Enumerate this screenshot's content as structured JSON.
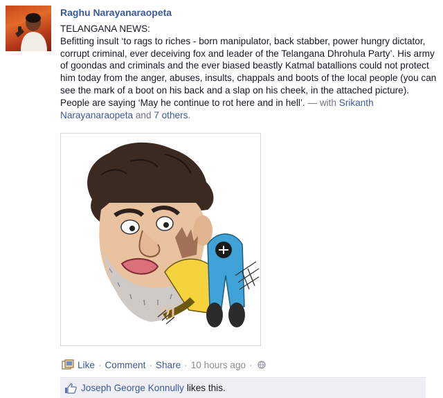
{
  "author": {
    "name": "Raghu Narayanaraopeta"
  },
  "post": {
    "headline": "TELANGANA NEWS:",
    "body": "Befitting insult ‘to rags to riches - born manipulator, back stabber, power hungry dictator, corrupt criminal, ever deceiving fox and leader of the Telangana Dhrohula Party’. His army of goondas and criminals and the ever biased beastly Katmal batallions could not protect him today from the anger, abuses, insults, chappals and boots of the local people (you can see the mark of a boot on his back and a slap on his cheek, in the attached picture). People are saying ‘May he continue to rot here and in hell’.",
    "with_prefix": " — with ",
    "tagged_user": "Srikanth Narayanaraopeta",
    "and_text": " and ",
    "others_link": "7 others",
    "end": "."
  },
  "actions": {
    "like": "Like",
    "comment": "Comment",
    "share": "Share",
    "separator": "·",
    "timestamp": "10 hours ago"
  },
  "likes": {
    "user": "Joseph George Konnully",
    "suffix": "likes this."
  },
  "colors": {
    "link": "#3b5998",
    "likes_bg": "#edeff4",
    "meta_gray": "#8c8c8c"
  },
  "icons": {
    "share": "share-icon",
    "privacy": "globe-icon",
    "like": "thumbs-up-icon"
  }
}
